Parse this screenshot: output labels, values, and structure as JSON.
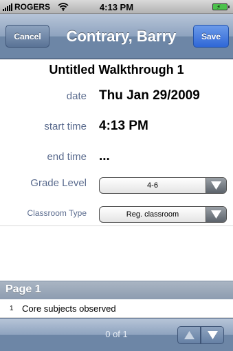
{
  "status_bar": {
    "carrier": "ROGERS",
    "time": "4:13 PM"
  },
  "nav": {
    "cancel_label": "Cancel",
    "title": "Contrary, Barry",
    "save_label": "Save"
  },
  "form": {
    "title": "Untitled Walkthrough 1",
    "date_label": "date",
    "date_value": "Thu Jan 29/2009",
    "start_time_label": "start time",
    "start_time_value": "4:13 PM",
    "end_time_label": "end time",
    "end_time_value": "...",
    "grade_level_label": "Grade Level",
    "grade_level_value": "4-6",
    "classroom_type_label": "Classroom Type",
    "classroom_type_value": "Reg. classroom"
  },
  "section": {
    "header": "Page 1",
    "items": [
      {
        "number": "1",
        "label": "Core subjects observed"
      }
    ]
  },
  "toolbar": {
    "pager_text": "0 of 1"
  },
  "colors": {
    "navbar": "#6d86a6",
    "label_text": "#5a6b8e",
    "save_button": "#2f67d6"
  }
}
